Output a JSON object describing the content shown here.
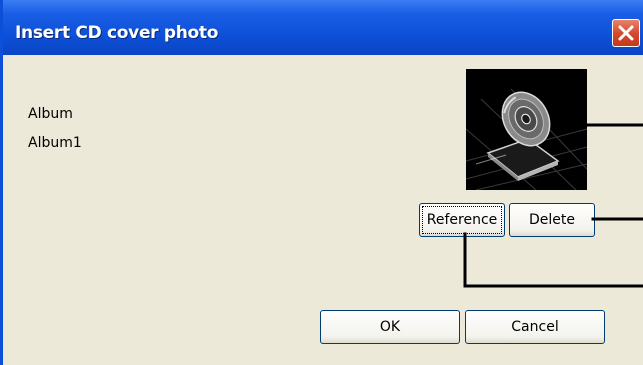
{
  "window": {
    "title": "Insert CD cover photo"
  },
  "album": {
    "label": "Album",
    "value": "Album1"
  },
  "buttons": {
    "reference": "Reference",
    "delete": "Delete",
    "ok": "OK",
    "cancel": "Cancel"
  },
  "icons": {
    "close": "close-icon",
    "cover": "cd-cover-image"
  },
  "colors": {
    "titlebar": "#0d4ed6",
    "close_button": "#d4472a",
    "dialog_background": "#ece9d8",
    "button_border": "#003c74"
  }
}
